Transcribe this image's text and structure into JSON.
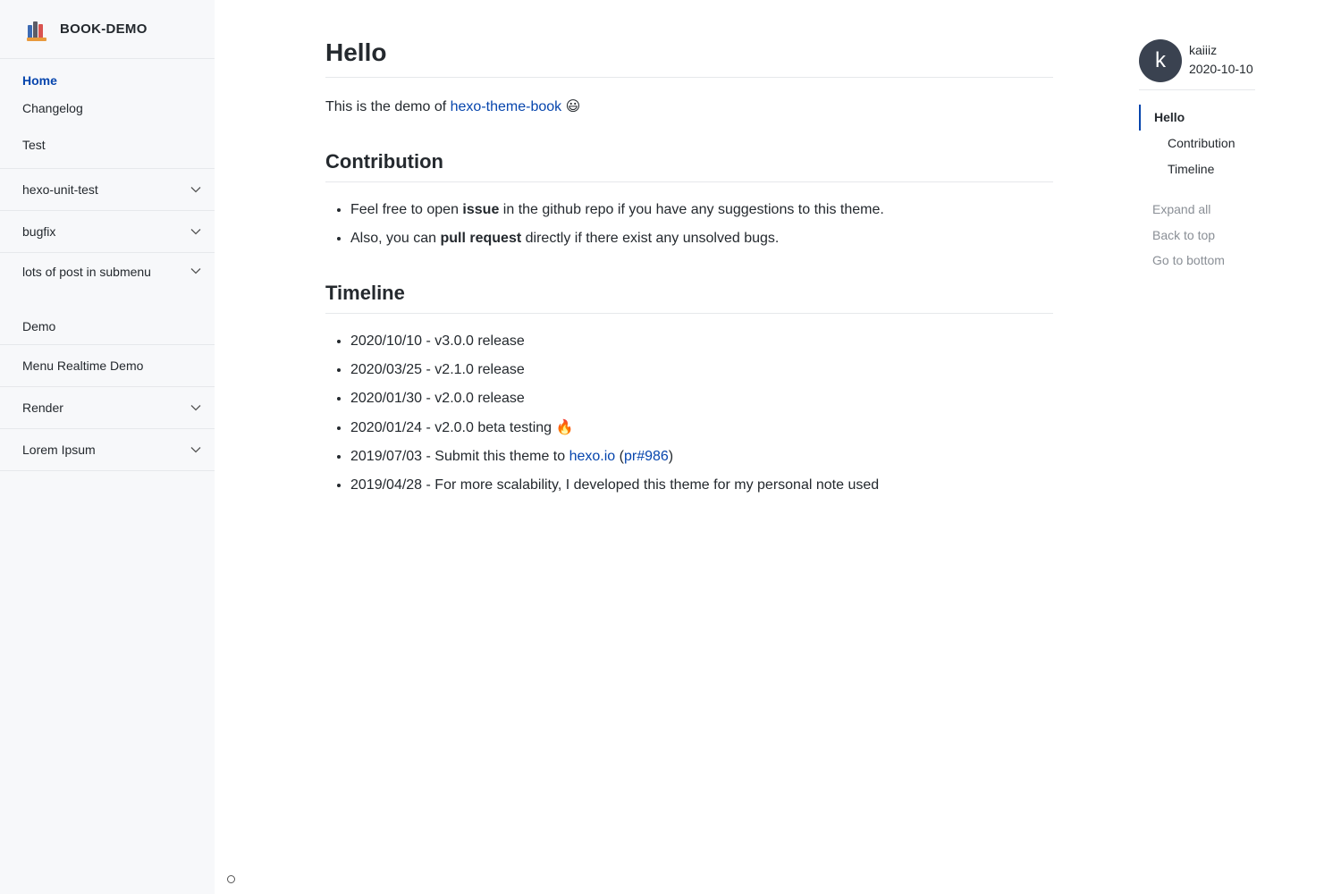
{
  "sidebar": {
    "brand": "BOOK-DEMO",
    "top_links": [
      {
        "label": "Home",
        "active": true
      },
      {
        "label": "Changelog"
      },
      {
        "label": "Test"
      }
    ],
    "groups": [
      {
        "label": "hexo-unit-test",
        "expandable": true
      },
      {
        "label": "bugfix",
        "expandable": true
      },
      {
        "label": "lots of post in submenu",
        "expandable": true
      },
      {
        "label": "Demo",
        "expandable": false
      },
      {
        "label": "Menu Realtime Demo",
        "expandable": false
      },
      {
        "label": "Render",
        "expandable": true
      },
      {
        "label": "Lorem Ipsum",
        "expandable": true
      }
    ]
  },
  "article": {
    "title": "Hello",
    "intro_text": "This is the demo of ",
    "intro_link": "hexo-theme-book",
    "intro_emoji": "😃",
    "contribution": {
      "heading": "Contribution",
      "items": [
        {
          "before": "Feel free to open ",
          "bold": "issue",
          "after": " in the github repo if you have any suggestions to this theme."
        },
        {
          "before": "Also, you can ",
          "bold": "pull request",
          "after": " directly if there exist any unsolved bugs."
        }
      ]
    },
    "timeline": {
      "heading": "Timeline",
      "items": [
        "2020/10/10 - v3.0.0 release",
        "2020/03/25 - v2.1.0 release",
        "2020/01/30 - v2.0.0 release",
        "2020/01/24 - v2.0.0 beta testing "
      ],
      "beta_emoji": "🔥",
      "submit_text": "2019/07/03 - Submit this theme to ",
      "submit_link": "hexo.io",
      "submit_paren_open": " (",
      "submit_pr_link": "pr#986",
      "submit_paren_close": ")",
      "last_item": "2019/04/28 - For more scalability, I developed this theme for my personal note used"
    }
  },
  "toc": {
    "author_initial": "k",
    "author_name": "kaiiiz",
    "date": "2020-10-10",
    "items": [
      {
        "label": "Hello",
        "level": 1
      },
      {
        "label": "Contribution",
        "level": 2
      },
      {
        "label": "Timeline",
        "level": 2
      }
    ],
    "actions": {
      "expand_all": "Expand all",
      "back_to_top": "Back to top",
      "go_to_bottom": "Go to bottom"
    }
  },
  "colors": {
    "accent": "#0645ad",
    "sidebar_bg": "#f7f8fa",
    "avatar_bg": "#3a4250",
    "muted": "#8a8f96"
  },
  "icons": {
    "chevron": "chevron-down-icon",
    "logo": "books-logo-icon"
  }
}
